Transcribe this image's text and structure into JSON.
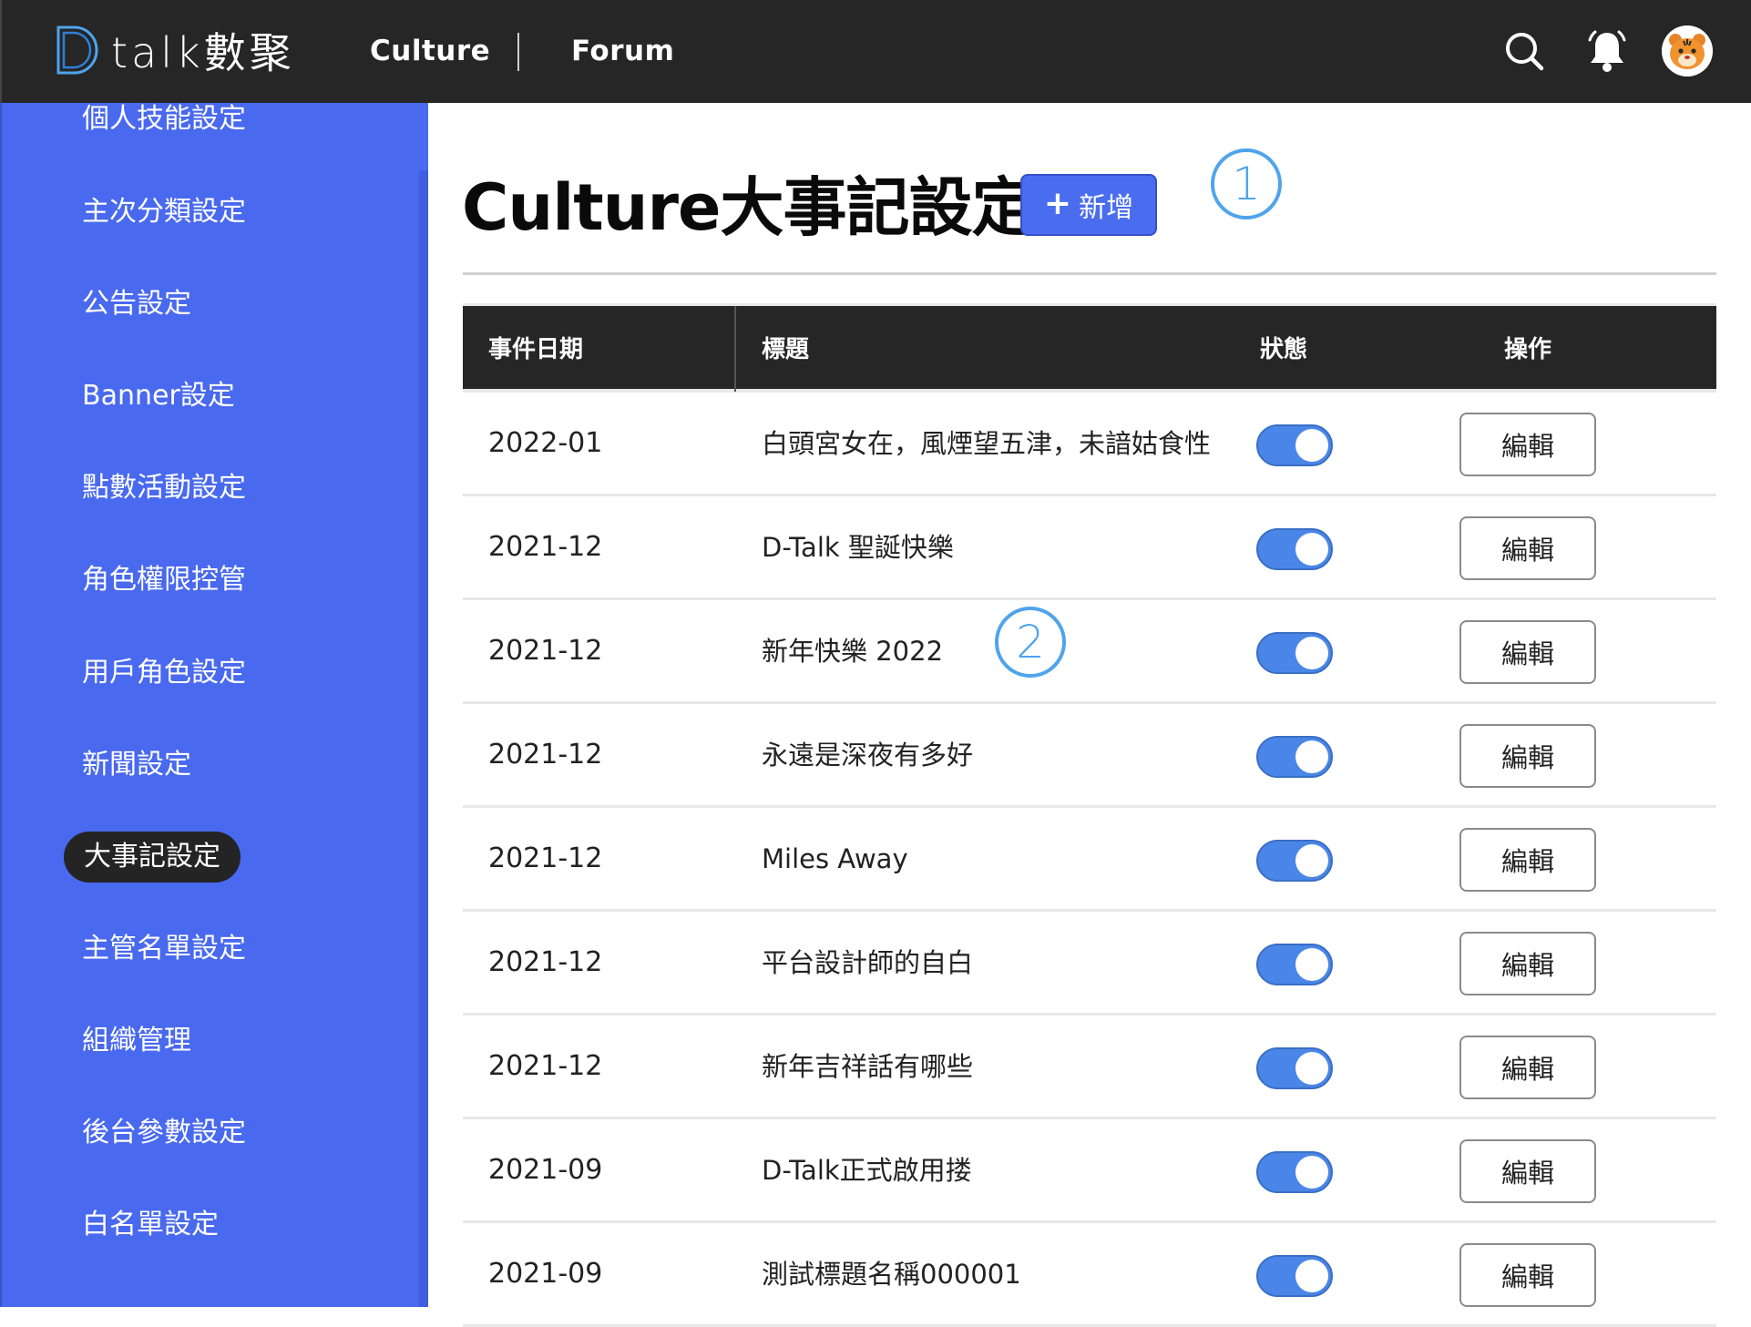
{
  "header": {
    "logo_text": "talk數聚",
    "nav": [
      {
        "label": "Culture"
      },
      {
        "label": "Forum"
      }
    ]
  },
  "sidebar": {
    "items": [
      {
        "label": "個人技能設定"
      },
      {
        "label": "主次分類設定"
      },
      {
        "label": "公告設定"
      },
      {
        "label": "Banner設定"
      },
      {
        "label": "點數活動設定"
      },
      {
        "label": "角色權限控管"
      },
      {
        "label": "用戶角色設定"
      },
      {
        "label": "新聞設定"
      },
      {
        "label": "大事記設定",
        "active": true
      },
      {
        "label": "主管名單設定"
      },
      {
        "label": "組織管理"
      },
      {
        "label": "後台參數設定"
      },
      {
        "label": "白名單設定"
      }
    ]
  },
  "main": {
    "title": "Culture大事記設定",
    "add_button": {
      "plus": "+",
      "label": "新增"
    },
    "markers": [
      "1",
      "2"
    ],
    "table": {
      "headers": {
        "date": "事件日期",
        "title": "標題",
        "status": "狀態",
        "action": "操作"
      },
      "rows": [
        {
          "date": "2022-01",
          "title": "白頭宮女在，風煙望五津，未諳姑食性",
          "enabled": true,
          "action": "編輯"
        },
        {
          "date": "2021-12",
          "title": "D-Talk 聖誕快樂",
          "enabled": true,
          "action": "編輯"
        },
        {
          "date": "2021-12",
          "title": "新年快樂 2022",
          "enabled": true,
          "action": "編輯"
        },
        {
          "date": "2021-12",
          "title": "永遠是深夜有多好",
          "enabled": true,
          "action": "編輯"
        },
        {
          "date": "2021-12",
          "title": "Miles Away",
          "enabled": true,
          "action": "編輯"
        },
        {
          "date": "2021-12",
          "title": "平台設計師的自白",
          "enabled": true,
          "action": "編輯"
        },
        {
          "date": "2021-12",
          "title": "新年吉祥話有哪些",
          "enabled": true,
          "action": "編輯"
        },
        {
          "date": "2021-09",
          "title": "D-Talk正式啟用搂",
          "enabled": true,
          "action": "編輯"
        },
        {
          "date": "2021-09",
          "title": "測試標題名稱000001",
          "enabled": true,
          "action": "編輯"
        }
      ]
    }
  },
  "colors": {
    "topbar": "#262626",
    "sidebar": "#4969ef",
    "primary_button": "#4a6df0",
    "toggle_on": "#4a86e8",
    "marker": "#4fa4ec"
  },
  "icons": [
    "d-logo-icon",
    "search-icon",
    "bell-icon",
    "tiger-avatar-icon",
    "plus-icon"
  ]
}
